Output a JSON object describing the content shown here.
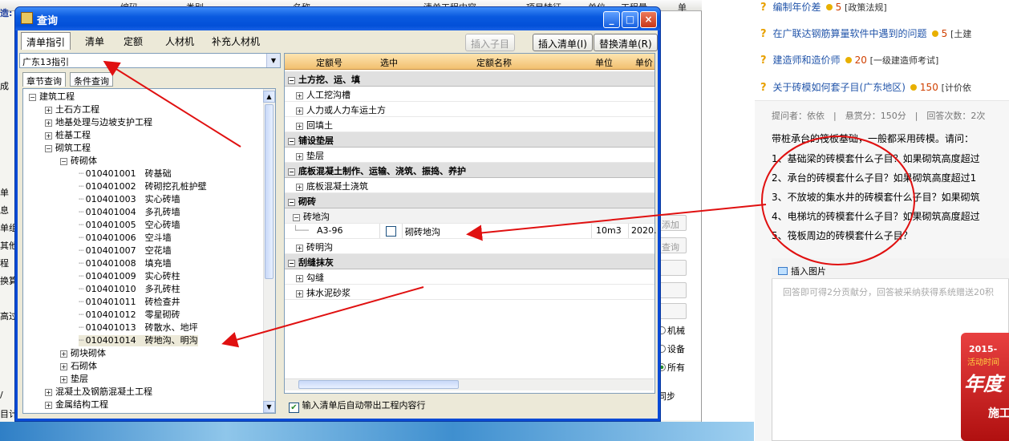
{
  "bg_columns": [
    "编码",
    "类别",
    "名称",
    "清单工程内容",
    "项目特征",
    "单位",
    "工程量",
    "单"
  ],
  "bg_left": [
    "造:",
    "成",
    "单",
    "息",
    "单组",
    "其他",
    "程",
    "换算",
    "高过",
    "/",
    "目计"
  ],
  "bg_side_buttons": [
    "添加",
    "查询"
  ],
  "bg_radios": [
    "机械",
    "设备",
    "所有"
  ],
  "bg_sync": "同步",
  "dialog": {
    "title": "查询",
    "tabs": [
      "清单指引",
      "清单",
      "定额",
      "人材机",
      "补充人材机"
    ],
    "buttons": {
      "insert_child": "插入子目",
      "insert_list": "插入清单(I)",
      "replace_list": "替换清单(R)"
    },
    "combo_value": "广东13指引",
    "subtabs": [
      "章节查询",
      "条件查询"
    ],
    "tree": [
      {
        "level": 0,
        "sign": "−",
        "text": "建筑工程"
      },
      {
        "level": 1,
        "sign": "+",
        "text": "土石方工程"
      },
      {
        "level": 1,
        "sign": "+",
        "text": "地基处理与边坡支护工程"
      },
      {
        "level": 1,
        "sign": "+",
        "text": "桩基工程"
      },
      {
        "level": 1,
        "sign": "−",
        "text": "砌筑工程"
      },
      {
        "level": 2,
        "sign": "−",
        "text": "砖砌体"
      },
      {
        "level": 3,
        "sign": "",
        "text": "010401001　砖基础"
      },
      {
        "level": 3,
        "sign": "",
        "text": "010401002　砖砌挖孔桩护壁"
      },
      {
        "level": 3,
        "sign": "",
        "text": "010401003　实心砖墙"
      },
      {
        "level": 3,
        "sign": "",
        "text": "010401004　多孔砖墙"
      },
      {
        "level": 3,
        "sign": "",
        "text": "010401005　空心砖墙"
      },
      {
        "level": 3,
        "sign": "",
        "text": "010401006　空斗墙"
      },
      {
        "level": 3,
        "sign": "",
        "text": "010401007　空花墙"
      },
      {
        "level": 3,
        "sign": "",
        "text": "010401008　填充墙"
      },
      {
        "level": 3,
        "sign": "",
        "text": "010401009　实心砖柱"
      },
      {
        "level": 3,
        "sign": "",
        "text": "010401010　多孔砖柱"
      },
      {
        "level": 3,
        "sign": "",
        "text": "010401011　砖检查井"
      },
      {
        "level": 3,
        "sign": "",
        "text": "010401012　零星砌砖"
      },
      {
        "level": 3,
        "sign": "",
        "text": "010401013　砖散水、地坪"
      },
      {
        "level": 3,
        "sign": "",
        "text": "010401014　砖地沟、明沟"
      },
      {
        "level": 2,
        "sign": "+",
        "text": "砌块砌体"
      },
      {
        "level": 2,
        "sign": "+",
        "text": "石砌体"
      },
      {
        "level": 2,
        "sign": "+",
        "text": "垫层"
      },
      {
        "level": 1,
        "sign": "+",
        "text": "混凝土及钢筋混凝土工程"
      },
      {
        "level": 1,
        "sign": "+",
        "text": "金属结构工程"
      }
    ],
    "grid_headers": [
      "定额号",
      "选中",
      "定额名称",
      "单位",
      "单价"
    ],
    "grid_rows": [
      {
        "type": "group",
        "sign": "−",
        "text": "土方挖、运、填"
      },
      {
        "type": "sub",
        "sign": "+",
        "text": "人工挖沟槽"
      },
      {
        "type": "sub",
        "sign": "+",
        "text": "人力或人力车运土方"
      },
      {
        "type": "sub",
        "sign": "+",
        "text": "回填土"
      },
      {
        "type": "group",
        "sign": "−",
        "text": "铺设垫层"
      },
      {
        "type": "sub",
        "sign": "+",
        "text": "垫层"
      },
      {
        "type": "group",
        "sign": "−",
        "text": "底板混凝土制作、运输、浇筑、振捣、养护"
      },
      {
        "type": "sub",
        "sign": "+",
        "text": "底板混凝土浇筑"
      },
      {
        "type": "group",
        "sign": "−",
        "text": "砌砖"
      },
      {
        "type": "sub2",
        "sign": "−",
        "text": "砖地沟"
      },
      {
        "type": "item",
        "code": "A3-96",
        "name": "砌砖地沟",
        "unit": "10m3",
        "price": "2020."
      },
      {
        "type": "sub",
        "sign": "+",
        "text": "砖明沟"
      },
      {
        "type": "group",
        "sign": "−",
        "text": "刮缝抹灰"
      },
      {
        "type": "sub",
        "sign": "+",
        "text": "勾缝"
      },
      {
        "type": "sub",
        "sign": "+",
        "text": "抹水泥砂浆"
      }
    ],
    "auto_check": "输入清单后自动带出工程内容行"
  },
  "web": {
    "questions": [
      {
        "title": "编制年价差",
        "coins": "5",
        "tag": "[政策法规]"
      },
      {
        "title": "在广联达钢筋算量软件中遇到的问题",
        "coins": "5",
        "tag": "[土建"
      },
      {
        "title": "建造师和造价师",
        "coins": "20",
        "tag": "[一级建造师考试]"
      },
      {
        "title": "关于砖模如何套子目(广东地区)",
        "coins": "150",
        "tag": "[计价依"
      }
    ],
    "meta": "提问者：依依　|　悬赏分：150分　|　回答次数：2次",
    "body": [
      "带桩承台的筏板基础，一般都采用砖模。请问：",
      "1、基础梁的砖模套什么子目？如果砌筑高度超过",
      "2、承台的砖模套什么子目？如果砌筑高度超过1",
      "3、不放坡的集水井的砖模套什么子目？如果砌筑",
      "4、电梯坑的砖模套什么子目？如果砌筑高度超过",
      "5、筏板周边的砖模套什么子目？"
    ],
    "insert_image": "插入图片",
    "placeholder": "回答即可得2分贡献分，回答被采纳获得系统赠送20积",
    "ad_text": [
      "2015-",
      "活动时间",
      "年度",
      "施工"
    ]
  },
  "colors": {
    "title_blue": "#0a5ae0",
    "arrow_red": "#e01010",
    "link_blue": "#2255aa",
    "coin": "#e8b000"
  }
}
